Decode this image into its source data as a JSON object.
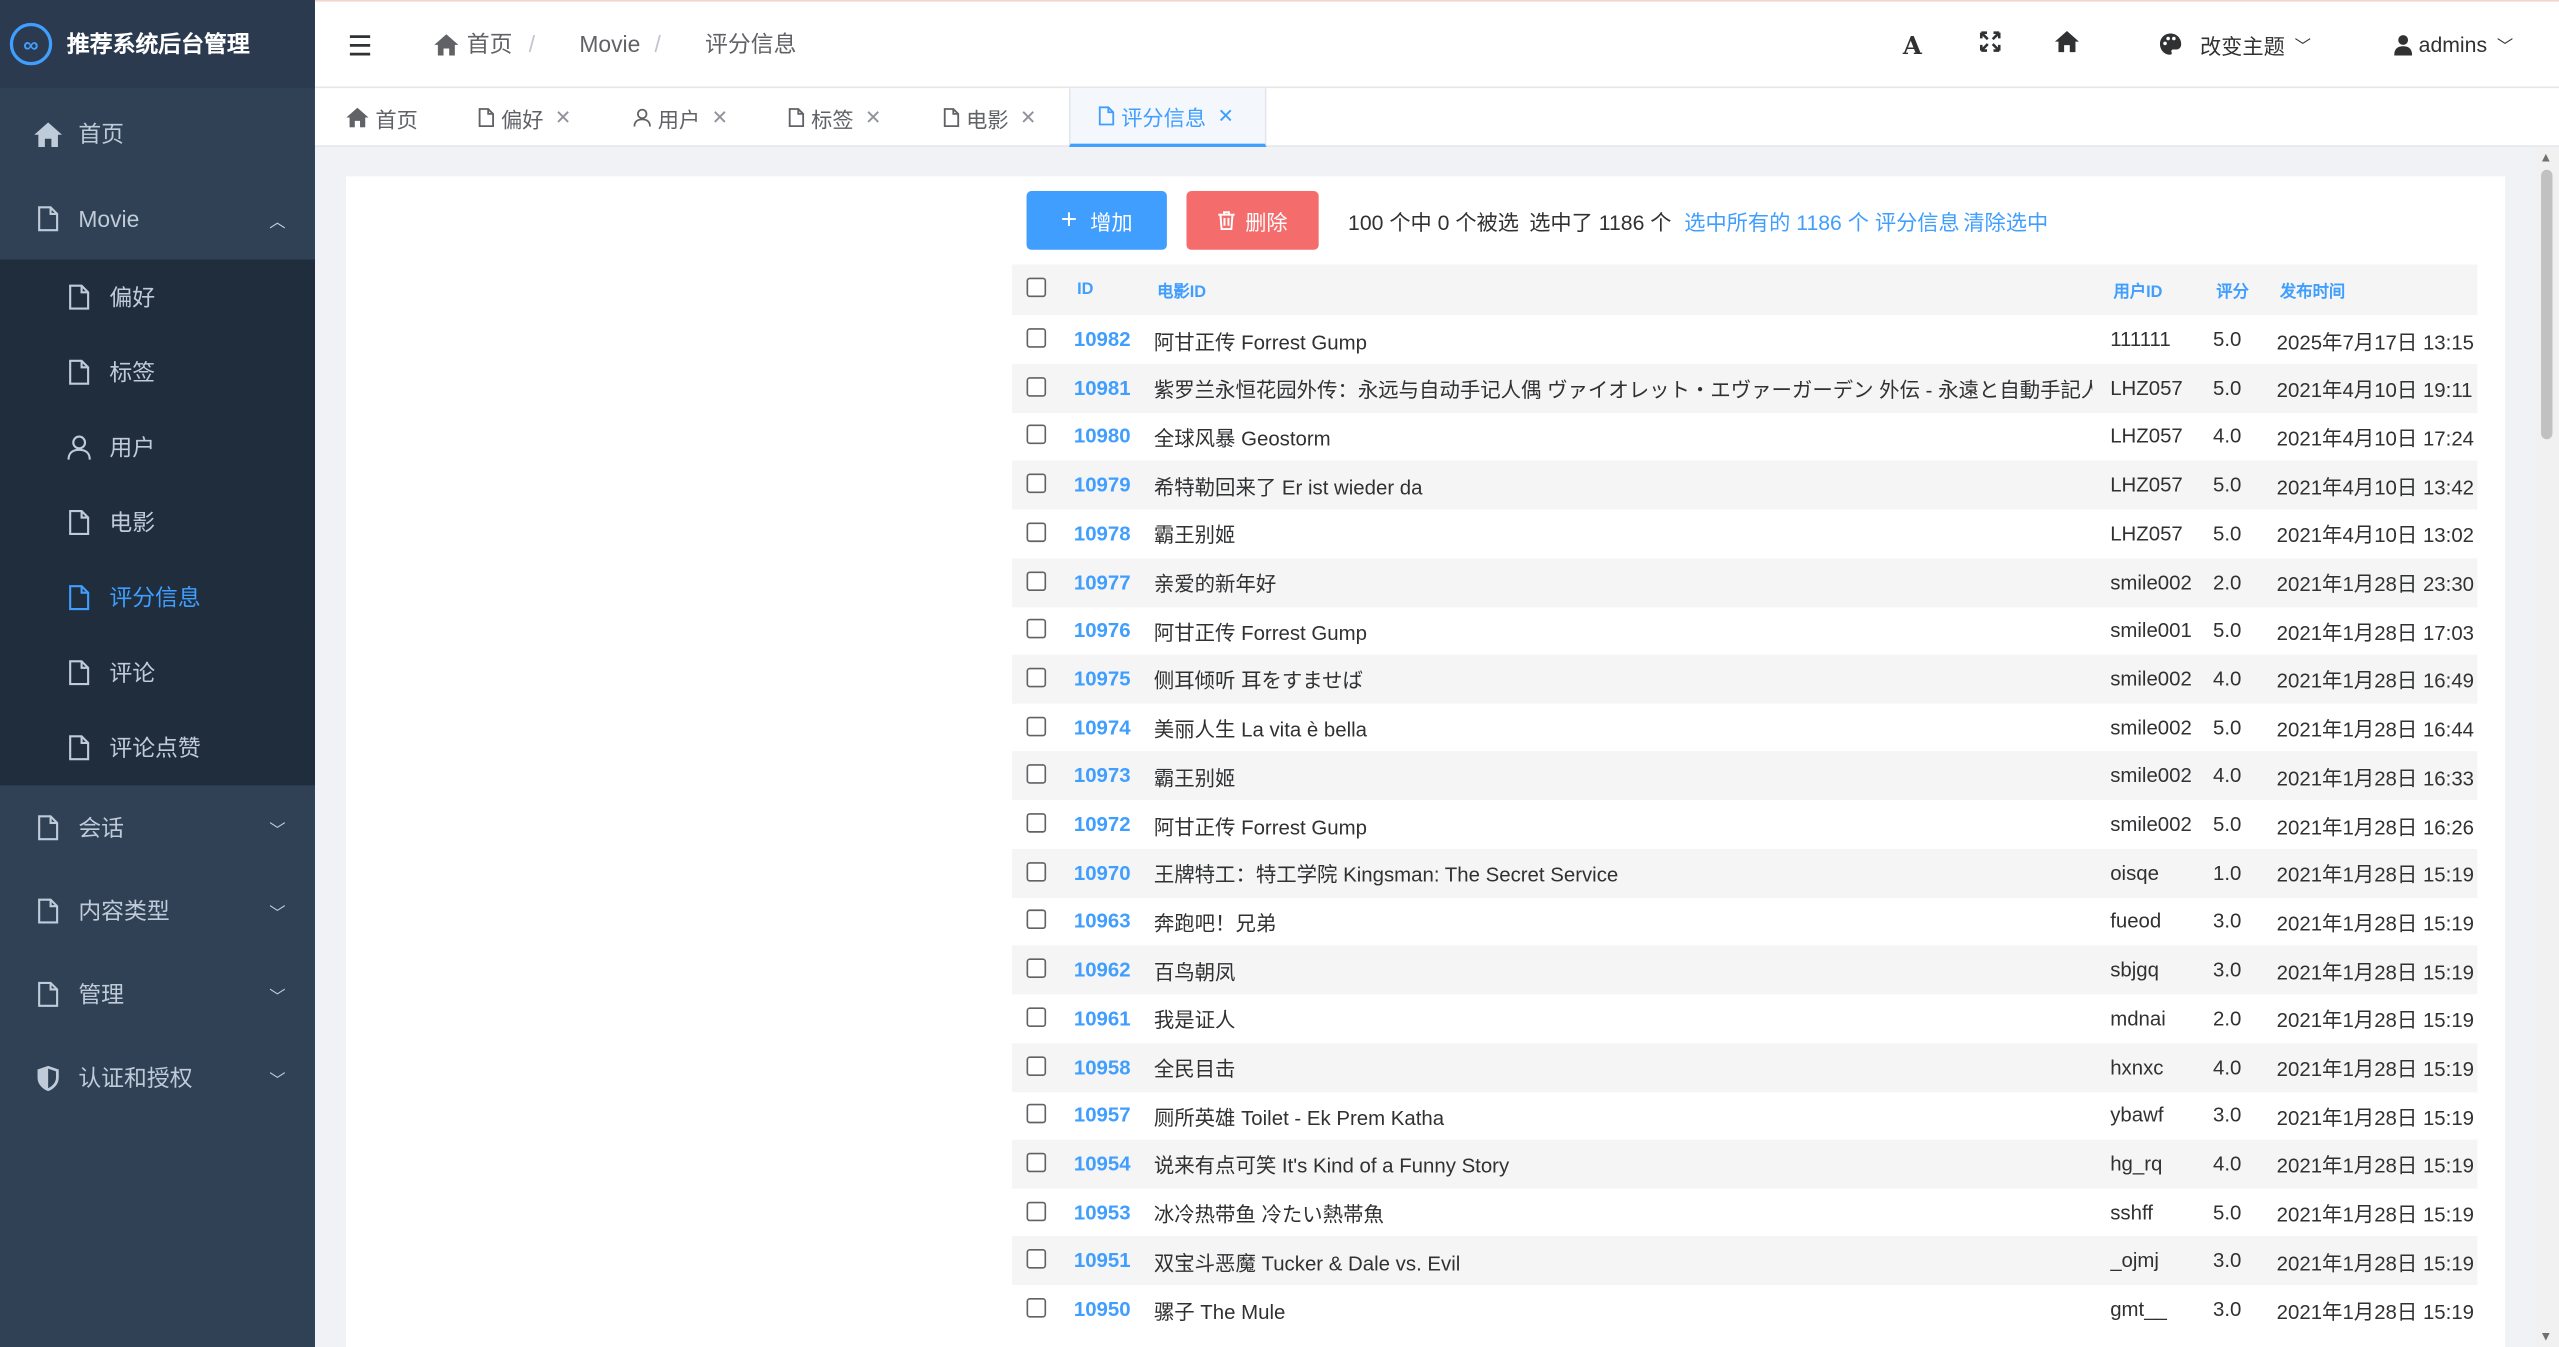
{
  "brand": {
    "title": "推荐系统后台管理",
    "logo_text": "∞"
  },
  "sidebar": {
    "items": [
      {
        "label": "首页",
        "icon": "home-icon"
      },
      {
        "label": "Movie",
        "icon": "file-icon",
        "expanded": true
      },
      {
        "label": "偏好",
        "icon": "file-icon"
      },
      {
        "label": "标签",
        "icon": "file-icon"
      },
      {
        "label": "用户",
        "icon": "user-icon"
      },
      {
        "label": "电影",
        "icon": "file-icon"
      },
      {
        "label": "评分信息",
        "icon": "file-icon",
        "active": true
      },
      {
        "label": "评论",
        "icon": "file-icon"
      },
      {
        "label": "评论点赞",
        "icon": "file-icon"
      },
      {
        "label": "会话",
        "icon": "file-icon"
      },
      {
        "label": "内容类型",
        "icon": "file-icon"
      },
      {
        "label": "管理",
        "icon": "file-icon"
      },
      {
        "label": "认证和授权",
        "icon": "shield-icon"
      }
    ]
  },
  "header": {
    "breadcrumb": [
      "首页",
      "Movie",
      "评分信息"
    ],
    "theme_label": "改变主题",
    "user_label": "admins"
  },
  "tabs": [
    {
      "label": "首页",
      "closable": false
    },
    {
      "label": "偏好",
      "closable": true
    },
    {
      "label": "用户",
      "closable": true
    },
    {
      "label": "标签",
      "closable": true
    },
    {
      "label": "电影",
      "closable": true
    },
    {
      "label": "评分信息",
      "closable": true,
      "active": true
    }
  ],
  "toolbar": {
    "add_label": "增加",
    "delete_label": "删除",
    "selection_count": "100 个中 0 个被选",
    "selected_total": "选中了 1186 个",
    "select_all_link": "选中所有的 1186 个 评分信息",
    "clear_link": "清除选中"
  },
  "table": {
    "columns": [
      "ID",
      "电影ID",
      "用户ID",
      "评分",
      "发布时间"
    ],
    "rows": [
      {
        "id": "10982",
        "movie": "阿甘正传 Forrest Gump",
        "user": "111111",
        "score": "5.0",
        "time": "2025年7月17日 13:15"
      },
      {
        "id": "10981",
        "movie": "紫罗兰永恒花园外传：永远与自动手记人偶 ヴァイオレット・エヴァーガーデン 外伝 - 永遠と自動手記人形 -",
        "user": "LHZ057",
        "score": "5.0",
        "time": "2021年4月10日 19:11"
      },
      {
        "id": "10980",
        "movie": "全球风暴 Geostorm",
        "user": "LHZ057",
        "score": "4.0",
        "time": "2021年4月10日 17:24"
      },
      {
        "id": "10979",
        "movie": "希特勒回来了 Er ist wieder da",
        "user": "LHZ057",
        "score": "5.0",
        "time": "2021年4月10日 13:42"
      },
      {
        "id": "10978",
        "movie": "霸王别姬",
        "user": "LHZ057",
        "score": "5.0",
        "time": "2021年4月10日 13:02"
      },
      {
        "id": "10977",
        "movie": "亲爱的新年好",
        "user": "smile002",
        "score": "2.0",
        "time": "2021年1月28日 23:30"
      },
      {
        "id": "10976",
        "movie": "阿甘正传 Forrest Gump",
        "user": "smile001",
        "score": "5.0",
        "time": "2021年1月28日 17:03"
      },
      {
        "id": "10975",
        "movie": "侧耳倾听 耳をすませば",
        "user": "smile002",
        "score": "4.0",
        "time": "2021年1月28日 16:49"
      },
      {
        "id": "10974",
        "movie": "美丽人生 La vita è bella",
        "user": "smile002",
        "score": "5.0",
        "time": "2021年1月28日 16:44"
      },
      {
        "id": "10973",
        "movie": "霸王别姬",
        "user": "smile002",
        "score": "4.0",
        "time": "2021年1月28日 16:33"
      },
      {
        "id": "10972",
        "movie": "阿甘正传 Forrest Gump",
        "user": "smile002",
        "score": "5.0",
        "time": "2021年1月28日 16:26"
      },
      {
        "id": "10970",
        "movie": "王牌特工：特工学院 Kingsman: The Secret Service",
        "user": "oisqe",
        "score": "1.0",
        "time": "2021年1月28日 15:19"
      },
      {
        "id": "10963",
        "movie": "奔跑吧！兄弟",
        "user": "fueod",
        "score": "3.0",
        "time": "2021年1月28日 15:19"
      },
      {
        "id": "10962",
        "movie": "百鸟朝凤",
        "user": "sbjgq",
        "score": "3.0",
        "time": "2021年1月28日 15:19"
      },
      {
        "id": "10961",
        "movie": "我是证人",
        "user": "mdnai",
        "score": "2.0",
        "time": "2021年1月28日 15:19"
      },
      {
        "id": "10958",
        "movie": "全民目击",
        "user": "hxnxc",
        "score": "4.0",
        "time": "2021年1月28日 15:19"
      },
      {
        "id": "10957",
        "movie": "厕所英雄 Toilet - Ek Prem Katha",
        "user": "ybawf",
        "score": "3.0",
        "time": "2021年1月28日 15:19"
      },
      {
        "id": "10954",
        "movie": "说来有点可笑 It's Kind of a Funny Story",
        "user": "hg_rq",
        "score": "4.0",
        "time": "2021年1月28日 15:19"
      },
      {
        "id": "10953",
        "movie": "冰冷热带鱼 冷たい熱帯魚",
        "user": "sshff",
        "score": "5.0",
        "time": "2021年1月28日 15:19"
      },
      {
        "id": "10951",
        "movie": "双宝斗恶魔 Tucker & Dale vs. Evil",
        "user": "_ojmj",
        "score": "3.0",
        "time": "2021年1月28日 15:19"
      },
      {
        "id": "10950",
        "movie": "骡子 The Mule",
        "user": "gmt__",
        "score": "3.0",
        "time": "2021年1月28日 15:19"
      }
    ]
  },
  "colors": {
    "sidebar_bg": "#304156",
    "accent": "#409eff",
    "danger": "#f56c6c"
  }
}
